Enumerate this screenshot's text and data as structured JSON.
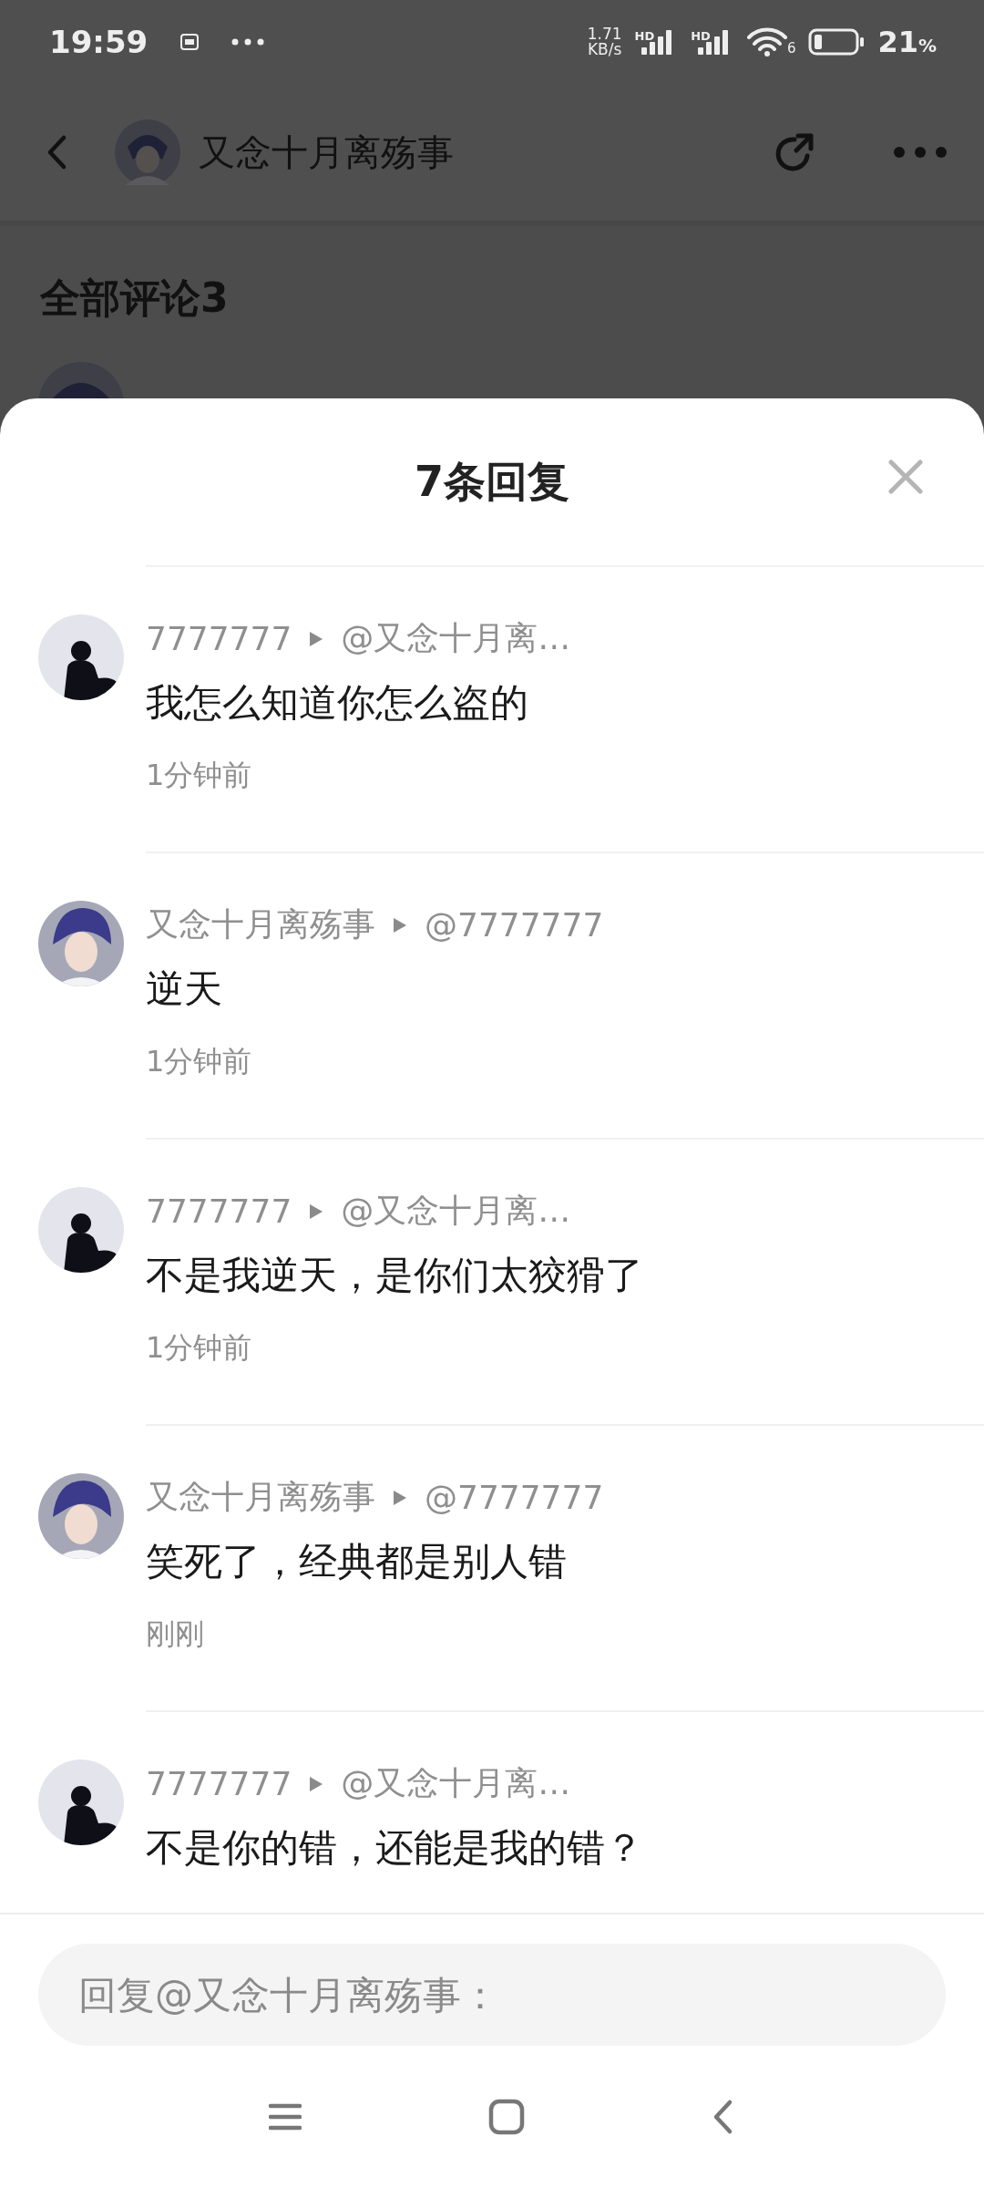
{
  "status_bar": {
    "time": "19:59",
    "speed_value": "1.71",
    "speed_unit": "KB/s",
    "signal_labels": [
      "HD",
      "HD"
    ],
    "wifi_label": "6",
    "battery": "21",
    "battery_unit": "%"
  },
  "header": {
    "title": "又念十月离殇事"
  },
  "section_title": "全部评论3",
  "sheet": {
    "title": "7条回复",
    "replies": [
      {
        "kind": "silhouette",
        "author": "7777777",
        "target": "@又念十月离…",
        "text": "我怎么知道你怎么盗的",
        "time": "1分钟前"
      },
      {
        "kind": "character",
        "author": "又念十月离殇事",
        "target": "@7777777",
        "text": "逆天",
        "time": "1分钟前"
      },
      {
        "kind": "silhouette",
        "author": "7777777",
        "target": "@又念十月离…",
        "text": "不是我逆天，是你们太狡猾了",
        "time": "1分钟前"
      },
      {
        "kind": "character",
        "author": "又念十月离殇事",
        "target": "@7777777",
        "text": "笑死了，经典都是别人错",
        "time": "刚刚"
      },
      {
        "kind": "silhouette",
        "author": "7777777",
        "target": "@又念十月离…",
        "text": "不是你的错，还能是我的错？"
      }
    ],
    "reply_field": {
      "placeholder": "回复@又念十月离殇事："
    }
  }
}
